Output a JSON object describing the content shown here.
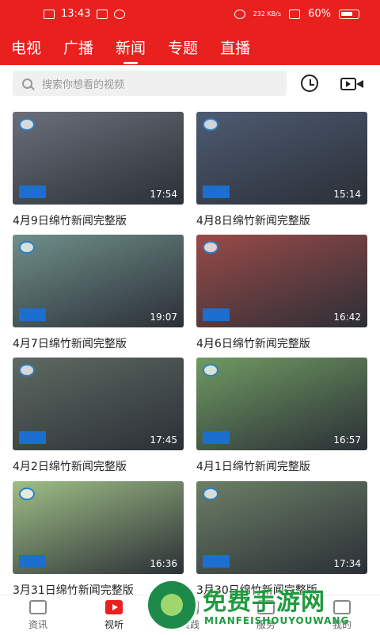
{
  "status_bar": {
    "time": "13:43",
    "net_speed": "232 KB/s",
    "battery": "60%"
  },
  "top_tabs": [
    {
      "label": "电视",
      "active": false
    },
    {
      "label": "广播",
      "active": false
    },
    {
      "label": "新闻",
      "active": true
    },
    {
      "label": "专题",
      "active": false
    },
    {
      "label": "直播",
      "active": false
    }
  ],
  "search": {
    "placeholder": "搜索你想看的视频",
    "icon": "search-icon"
  },
  "toolbar_icons": [
    "clock-icon",
    "video-camera-icon"
  ],
  "videos": [
    {
      "title": "4月9日绵竹新闻完整版",
      "duration": "17:54",
      "thumb_color": "#6a6f7a"
    },
    {
      "title": "4月8日绵竹新闻完整版",
      "duration": "15:14",
      "thumb_color": "#4d5b72"
    },
    {
      "title": "4月7日绵竹新闻完整版",
      "duration": "19:07",
      "thumb_color": "#6f8f8a"
    },
    {
      "title": "4月6日绵竹新闻完整版",
      "duration": "16:42",
      "thumb_color": "#9a4a48"
    },
    {
      "title": "4月2日绵竹新闻完整版",
      "duration": "17:45",
      "thumb_color": "#5e6a62"
    },
    {
      "title": "4月1日绵竹新闻完整版",
      "duration": "16:57",
      "thumb_color": "#6f9a62"
    },
    {
      "title": "3月31日绵竹新闻完整版",
      "duration": "16:36",
      "thumb_color": "#9fbf86"
    },
    {
      "title": "3月30日绵竹新闻完整版",
      "duration": "17:34",
      "thumb_color": "#6c7f66"
    }
  ],
  "bottom_nav": [
    {
      "label": "资讯",
      "active": false
    },
    {
      "label": "视听",
      "active": true
    },
    {
      "label": "实践",
      "active": false
    },
    {
      "label": "服务",
      "active": false
    },
    {
      "label": "我的",
      "active": false
    }
  ],
  "watermark": {
    "text": "免费手游网",
    "subtext": "MIANFEISHOUYOUWANG"
  },
  "colors": {
    "brand_red": "#e8201e",
    "watermark_green": "#1e9b3e"
  }
}
